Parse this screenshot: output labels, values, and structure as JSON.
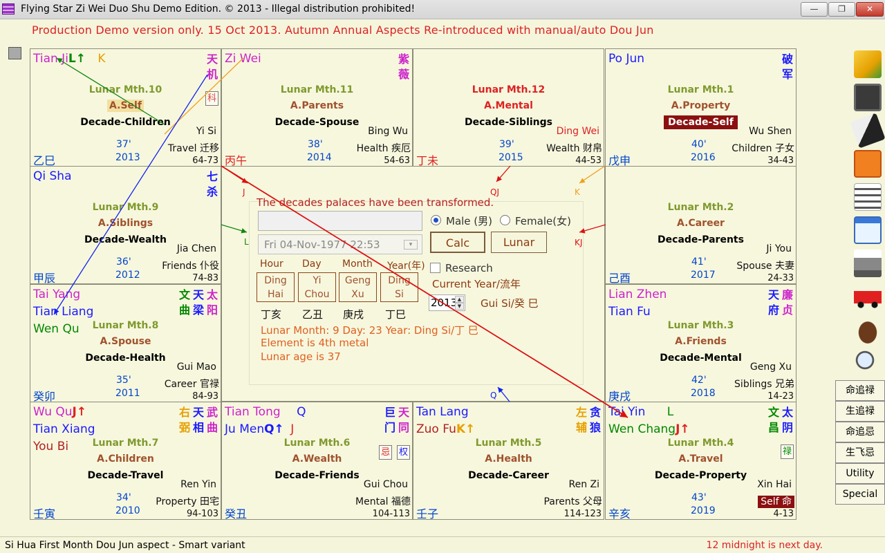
{
  "window": {
    "title": "Flying Star Zi Wei Duo Shu Demo Edition. © 2013 - Illegal distribution prohibited!",
    "minimize": "—",
    "maximize": "❐",
    "close": "✕"
  },
  "banner": "Production Demo version only. 15 Oct 2013.  Autumn Annual Aspects Re-introduced with manual/auto Dou Jun",
  "palaces": {
    "p1": {
      "lunar": "Lunar Mth.10",
      "aspect": "A.Self",
      "decade": "Decade-Children",
      "sector": "Yi Si",
      "age": "37'",
      "year": "2013",
      "palace": "Travel 迁移",
      "range": "64-73",
      "ganzhi": "乙巳",
      "star1": "Tian Ji",
      "star1_mark": "L↑",
      "star1_extra": "K",
      "cn1": [
        "天",
        "机"
      ],
      "box1": "科"
    },
    "p2": {
      "lunar": "Lunar Mth.11",
      "aspect": "A.Parents",
      "decade": "Decade-Spouse",
      "sector": "Bing Wu",
      "age": "38'",
      "year": "2014",
      "palace": "Health 疾厄",
      "range": "54-63",
      "ganzhi": "丙午",
      "star1": "Zi Wei",
      "cn1": [
        "紫",
        "薇"
      ]
    },
    "p3": {
      "lunar": "Lunar Mth.12",
      "aspect": "A.Mental",
      "decade": "Decade-Siblings",
      "sector": "Ding Wei",
      "age": "39'",
      "year": "2015",
      "palace": "Wealth 财帛",
      "range": "44-53",
      "ganzhi": "丁未"
    },
    "p4": {
      "lunar": "Lunar Mth.1",
      "aspect": "A.Property",
      "decade": "Decade-Self",
      "sector": "Wu Shen",
      "age": "40'",
      "year": "2016",
      "palace": "Children 子女",
      "range": "34-43",
      "ganzhi": "戊申",
      "star1": "Po Jun",
      "cn1": [
        "破",
        "军"
      ]
    },
    "p5": {
      "lunar": "Lunar Mth.9",
      "aspect": "A.Siblings",
      "decade": "Decade-Wealth",
      "sector": "Jia Chen",
      "age": "36'",
      "year": "2012",
      "palace": "Friends 仆役",
      "range": "74-83",
      "ganzhi": "甲辰",
      "star1": "Qi Sha",
      "cn1": [
        "七",
        "杀"
      ]
    },
    "p6": {
      "lunar": "Lunar Mth.2",
      "aspect": "A.Career",
      "decade": "Decade-Parents",
      "sector": "Ji You",
      "age": "41'",
      "year": "2017",
      "palace": "Spouse 夫妻",
      "range": "24-33",
      "ganzhi": "己酉"
    },
    "p7": {
      "lunar": "Lunar Mth.8",
      "aspect": "A.Spouse",
      "decade": "Decade-Health",
      "sector": "Gui Mao",
      "age": "35'",
      "year": "2011",
      "palace": "Career 官禄",
      "range": "84-93",
      "ganzhi": "癸卯",
      "star1": "Tai Yang",
      "star2": "Tian Liang",
      "star3": "Wen Qu",
      "cn1": [
        "文",
        "曲"
      ],
      "cn2": [
        "天",
        "梁"
      ],
      "cn3": [
        "太",
        "阳"
      ]
    },
    "p8": {
      "lunar": "Lunar Mth.3",
      "aspect": "A.Friends",
      "decade": "Decade-Mental",
      "sector": "Geng Xu",
      "age": "42'",
      "year": "2018",
      "palace": "Siblings 兄弟",
      "range": "14-23",
      "ganzhi": "庚戌",
      "star1": "Lian Zhen",
      "star2": "Tian Fu",
      "cn1": [
        "天",
        "府"
      ],
      "cn2": [
        "廉",
        "贞"
      ]
    },
    "p9": {
      "lunar": "Lunar Mth.7",
      "aspect": "A.Children",
      "decade": "Decade-Travel",
      "sector": "Ren Yin",
      "age": "34'",
      "year": "2010",
      "palace": "Property 田宅",
      "range": "94-103",
      "ganzhi": "壬寅",
      "star1": "Wu Qu",
      "star1_mark": "J↑",
      "star2": "Tian Xiang",
      "star3": "You Bi",
      "cn1": [
        "右",
        "弼"
      ],
      "cn2": [
        "天",
        "相"
      ],
      "cn3": [
        "武",
        "曲"
      ]
    },
    "p10": {
      "lunar": "Lunar Mth.6",
      "aspect": "A.Wealth",
      "decade": "Decade-Friends",
      "sector": "Gui Chou",
      "age": "",
      "year": "",
      "palace": "Mental 福德",
      "range": "104-113",
      "ganzhi": "癸丑",
      "star1": "Tian Tong",
      "star1_extra": "Q",
      "star2": "Ju Men",
      "star2_mark": "Q↑",
      "star2_extra": "J",
      "cn1": [
        "巨",
        "门"
      ],
      "cn2": [
        "天",
        "同"
      ],
      "box1": "忌",
      "box2": "权"
    },
    "p11": {
      "lunar": "Lunar Mth.5",
      "aspect": "A.Health",
      "decade": "Decade-Career",
      "sector": "Ren Zi",
      "age": "",
      "year": "",
      "palace": "Parents 父母",
      "range": "114-123",
      "ganzhi": "壬子",
      "star1": "Tan Lang",
      "star2": "Zuo Fu",
      "star2_mark": "K↑",
      "cn1": [
        "左",
        "辅"
      ],
      "cn2": [
        "贪",
        "狼"
      ]
    },
    "p12": {
      "lunar": "Lunar Mth.4",
      "aspect": "A.Travel",
      "decade": "Decade-Property",
      "sector": "Xin Hai",
      "age": "43'",
      "year": "2019",
      "palace": "Self 命",
      "range": "4-13",
      "ganzhi": "辛亥",
      "star1": "Tai Yin",
      "star1_extra": "L",
      "star2": "Wen Chang",
      "star2_mark": "J↑",
      "cn1": [
        "文",
        "昌"
      ],
      "cn2": [
        "太",
        "阴"
      ],
      "box1": "禄"
    }
  },
  "arrows": {
    "J": "J",
    "QJ": "QJ",
    "K": "K",
    "L": "L",
    "KJ": "KJ",
    "Q": "Q"
  },
  "calc": {
    "message": "The decades palaces have been transformed.",
    "name_value": "",
    "date_value": "Fri   04-Nov-1977 22:53",
    "male_label": "Male (男)",
    "female_label": "Female(女)",
    "calc_button": "Calc",
    "lunar_button": "Lunar",
    "col_hour": "Hour",
    "col_day": "Day",
    "col_month": "Month",
    "col_year": "Year(年)",
    "pillars": [
      {
        "top": "Ding",
        "bottom": "Hai",
        "cn": "丁亥"
      },
      {
        "top": "Yi",
        "bottom": "Chou",
        "cn": "乙丑"
      },
      {
        "top": "Geng",
        "bottom": "Xu",
        "cn": "庚戌"
      },
      {
        "top": "Ding",
        "bottom": "Si",
        "cn": "丁巳"
      }
    ],
    "research_label": "Research",
    "current_year_label": "Current Year/流年",
    "year_value": "2013",
    "year_ganzhi": "Gui Si/癸 巳",
    "info1": "Lunar Month: 9   Day: 23   Year: Ding Si/丁 巳",
    "info2": "Element is 4th metal",
    "info3": "Lunar age is 37"
  },
  "side_buttons": [
    "命追禄",
    "生追禄",
    "命追忌",
    "生飞忌",
    "Utility",
    "Special"
  ],
  "toolbar_icons": [
    "open-folder-icon",
    "save-disk-icon",
    "eraser-icon",
    "calculator-icon",
    "list-icon",
    "calendar-window-icon",
    "printer-icon",
    "car-icon",
    "mouse-icon",
    "magnifier-icon"
  ],
  "colors": {
    "background": "#f5f5dc",
    "palace_bg": "#f7f7de",
    "banner_red": "#dd2222",
    "lunar_olive": "#7f9a2e",
    "aspect_brown": "#a0522d",
    "self_badge": "#8b1010"
  },
  "status": {
    "left": "Si Hua First Month Dou Jun aspect - Smart variant",
    "right": "12 midnight is next day."
  }
}
